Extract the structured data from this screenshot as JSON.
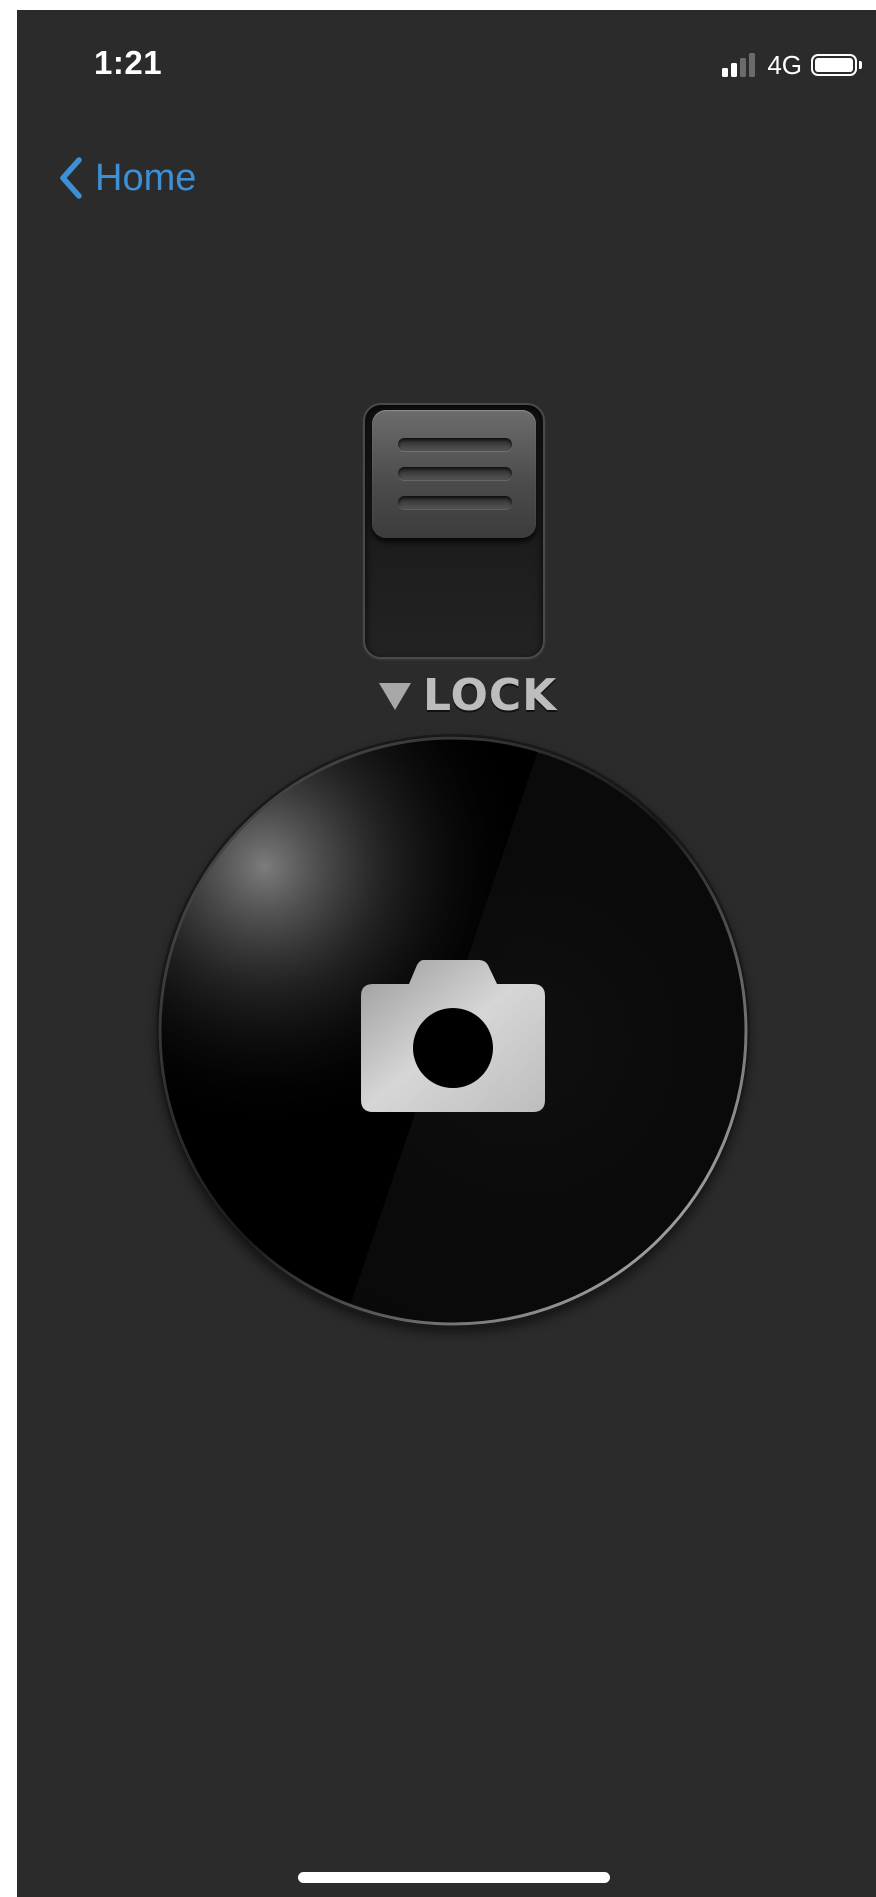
{
  "status_bar": {
    "time": "1:21",
    "network": "4G",
    "signal_bars_active": 2,
    "signal_bars_total": 4,
    "battery_icon": "battery-full-icon"
  },
  "nav": {
    "back_label": "Home",
    "back_icon": "chevron-left-icon"
  },
  "lock": {
    "label": "LOCK",
    "arrow_icon": "triangle-down-icon",
    "switch_icon": "slide-switch-icon"
  },
  "shutter": {
    "icon": "camera-icon"
  },
  "colors": {
    "background": "#2b2b2b",
    "accent": "#3d8fd6",
    "lock_text": "#bdbdbd"
  }
}
